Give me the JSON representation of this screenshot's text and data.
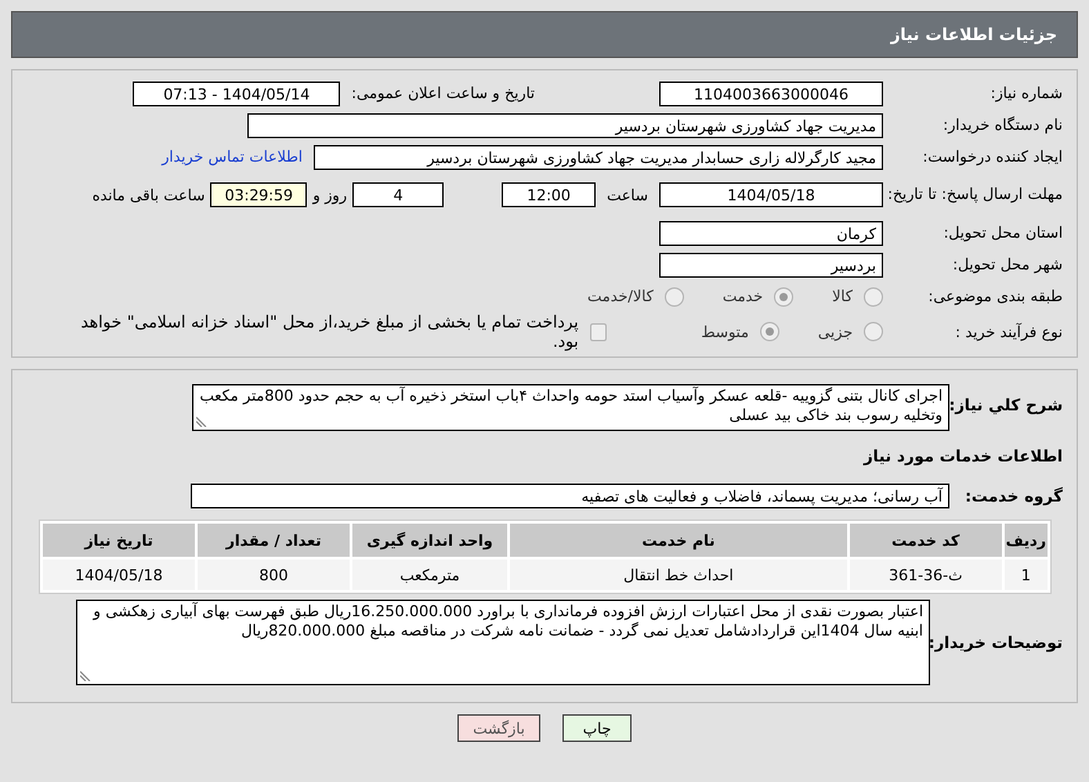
{
  "header": {
    "title": "جزئیات اطلاعات نیاز"
  },
  "need_number": {
    "label": "شماره نیاز:",
    "value": "1104003663000046"
  },
  "announce": {
    "label": "تاریخ و ساعت اعلان عمومی:",
    "value": "1404/05/14 - 07:13"
  },
  "buyer": {
    "label": "نام دستگاه خریدار:",
    "value": "مدیریت جهاد کشاورزی شهرستان بردسیر"
  },
  "creator": {
    "label": "ایجاد کننده درخواست:",
    "value": "مجید کارگرلاله زاری حسابدار مدیریت جهاد کشاورزی شهرستان بردسیر",
    "link": "اطلاعات تماس خریدار"
  },
  "deadline": {
    "label": "مهلت ارسال پاسخ: تا تاریخ:",
    "date": "1404/05/18",
    "time_label": "ساعت",
    "time": "12:00",
    "days": "4",
    "days_label": "روز و",
    "remaining": "03:29:59",
    "remaining_label": "ساعت باقی مانده"
  },
  "province": {
    "label": "استان محل تحویل:",
    "value": "کرمان"
  },
  "city": {
    "label": "شهر محل تحویل:",
    "value": "بردسیر"
  },
  "category": {
    "label": "طبقه بندی موضوعی:",
    "options": [
      {
        "label": "کالا",
        "selected": false
      },
      {
        "label": "خدمت",
        "selected": true
      },
      {
        "label": "کالا/خدمت",
        "selected": false
      }
    ]
  },
  "process": {
    "label": "نوع فرآیند خرید :",
    "options": [
      {
        "label": "جزیی",
        "selected": false
      },
      {
        "label": "متوسط",
        "selected": true
      }
    ],
    "payment": {
      "checked": false,
      "text": "پرداخت تمام یا بخشی از مبلغ خرید،از محل \"اسناد خزانه اسلامی\" خواهد بود."
    }
  },
  "description": {
    "label": "شرح کلي نياز:",
    "value": "اجرای کانال بتنی گزوییه -قلعه عسکر وآسیاب استد حومه واحداث ۴باب استخر ذخیره آب به حجم حدود 800متر مکعب وتخلیه رسوب  بند خاکی بید عسلی"
  },
  "services_title": "اطلاعات خدمات مورد نیاز",
  "service_group": {
    "label": "گروه خدمت:",
    "value": "آب رسانی؛ مدیریت پسماند، فاضلاب و فعالیت های تصفیه"
  },
  "table": {
    "columns": [
      "ردیف",
      "کد خدمت",
      "نام خدمت",
      "واحد اندازه گیری",
      "تعداد / مقدار",
      "تاریخ نیاز"
    ],
    "rows": [
      [
        "1",
        "ث-36-361",
        "احداث خط انتقال",
        "مترمکعب",
        "800",
        "1404/05/18"
      ]
    ]
  },
  "buyer_notes": {
    "label": "توضیحات خریدار:",
    "value": "اعتبار بصورت نقدی از محل اعتبارات ارزش افزوده فرمانداری با براورد 16.250.000.000ریال طبق فهرست بهای آبیاری زهکشی و ابنیه سال 1404این قراردادشامل تعدیل نمی گردد - ضمانت نامه شرکت در مناقصه مبلغ 820.000.000ریال"
  },
  "buttons": [
    {
      "label": "چاپ",
      "kind": "print"
    },
    {
      "label": "بازگشت",
      "kind": "back"
    }
  ]
}
